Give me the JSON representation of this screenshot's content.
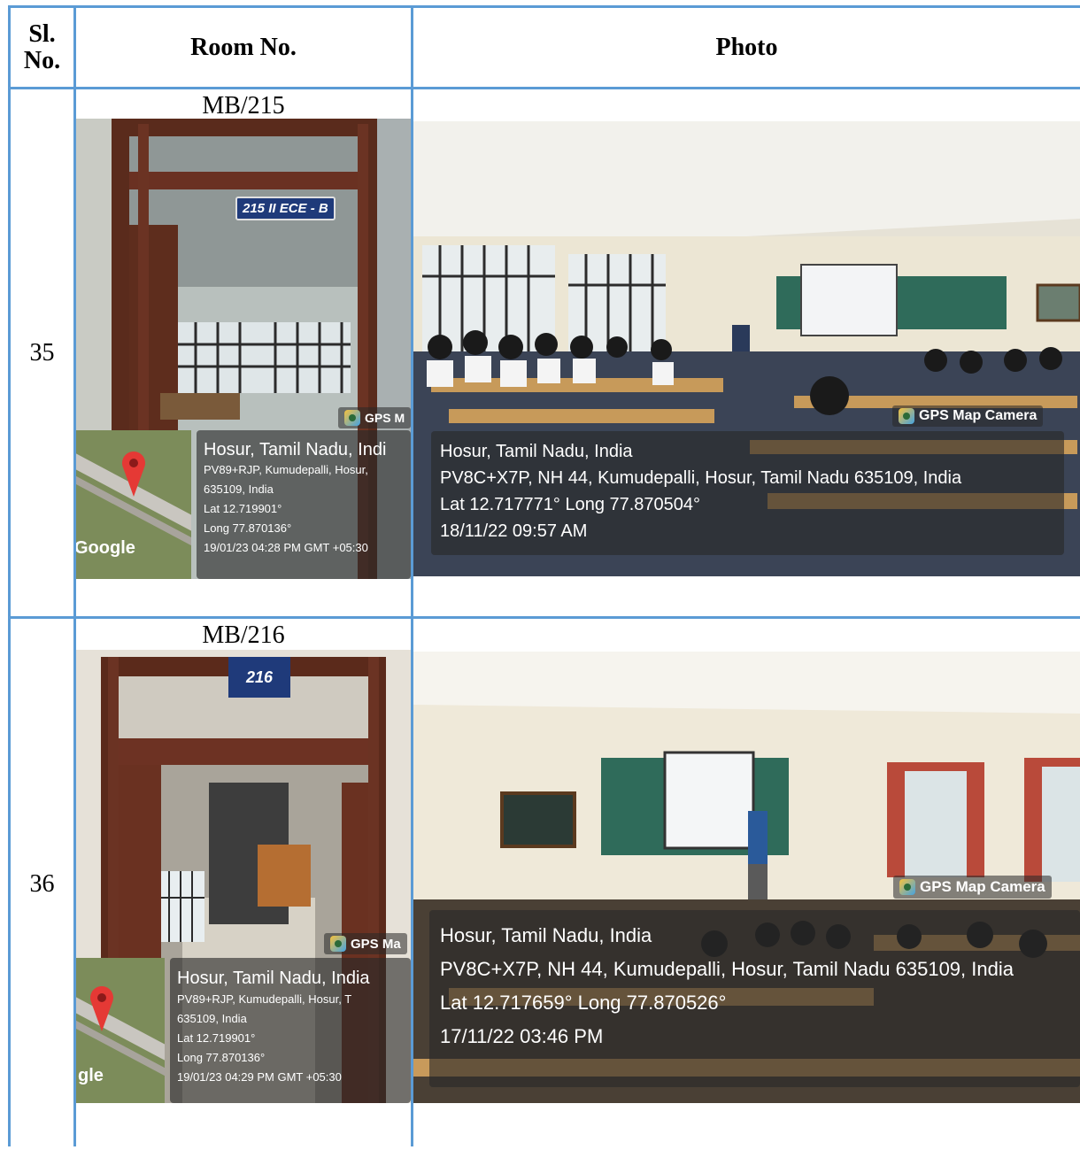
{
  "header": {
    "slno": "Sl. No.",
    "room": "Room No.",
    "photo": "Photo"
  },
  "rows": [
    {
      "slno": "35",
      "room": "MB/215",
      "door_photo": {
        "sign": "215 II ECE - B",
        "badge": "GPS M",
        "city": "Hosur, Tamil Nadu, Indi",
        "addr1": "PV89+RJP, Kumudepalli, Hosur,",
        "addr2": "635109, India",
        "lat": "Lat 12.719901°",
        "long": "Long 77.870136°",
        "datetime": "19/01/23 04:28 PM GMT +05:30",
        "map_label": "Google"
      },
      "class_photo": {
        "badge": "GPS Map Camera",
        "city": "Hosur, Tamil Nadu, India",
        "addr": "PV8C+X7P, NH 44, Kumudepalli, Hosur, Tamil Nadu 635109, India",
        "latlong": "Lat 12.717771° Long 77.870504°",
        "datetime": "18/11/22 09:57 AM"
      }
    },
    {
      "slno": "36",
      "room": "MB/216",
      "door_photo": {
        "sign": "216",
        "badge": "GPS Ma",
        "city": "Hosur, Tamil Nadu, India",
        "addr1": "PV89+RJP, Kumudepalli, Hosur, T",
        "addr2": "635109, India",
        "lat": "Lat 12.719901°",
        "long": "Long 77.870136°",
        "datetime": "19/01/23 04:29 PM GMT +05:30",
        "map_label": "gle"
      },
      "class_photo": {
        "badge": "GPS Map Camera",
        "city": "Hosur, Tamil Nadu, India",
        "addr": "PV8C+X7P, NH 44, Kumudepalli, Hosur, Tamil Nadu 635109, India",
        "latlong": "Lat 12.717659° Long 77.870526°",
        "datetime": "17/11/22 03:46 PM"
      }
    }
  ],
  "colors": {
    "grid": "#5b9bd5",
    "overlay": "#282828",
    "sign_blue": "#1f3a7a",
    "pin_red": "#e53935"
  }
}
